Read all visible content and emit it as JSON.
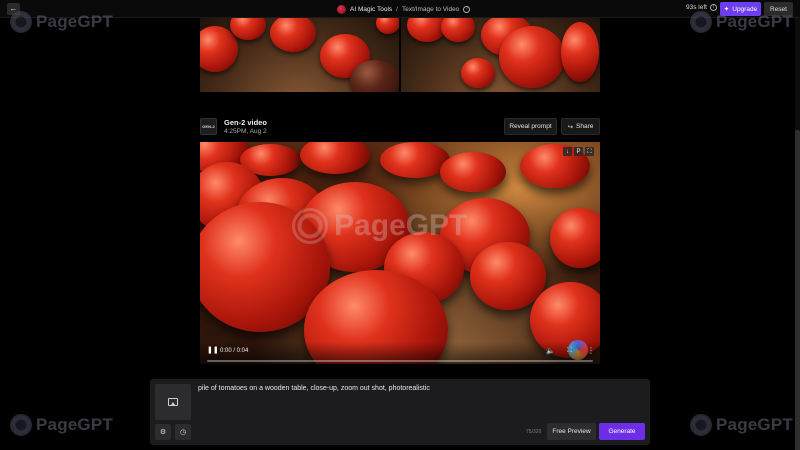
{
  "header": {
    "back_icon": "←",
    "breadcrumb_root": "AI Magic Tools",
    "breadcrumb_sep": "/",
    "breadcrumb_current": "Text/Image to Video",
    "help_icon": "?",
    "credits": "93s left",
    "info_icon": "i",
    "upgrade_icon": "✦",
    "upgrade_label": "Upgrade",
    "reset_label": "Reset"
  },
  "watermark": {
    "text": "PageGPT"
  },
  "result": {
    "avatar_text": "GEN-2",
    "title": "Gen-2 video",
    "timestamp": "4:25PM, Aug 2",
    "reveal_label": "Reveal prompt",
    "share_icon": "↪",
    "share_label": "Share"
  },
  "video": {
    "top_icons": [
      "↓",
      "P",
      "⛶"
    ],
    "play_icon": "❚❚",
    "time": "0:00 / 0:04",
    "mute_icon": "🔈",
    "fullscreen_icon": "⛶",
    "more_icon": "⋮",
    "progress_fraction": 0.0
  },
  "composer": {
    "prompt": "pile of tomatoes on a wooden table, close-up, zoom out shot, photorealistic",
    "settings_icon": "⚙",
    "history_icon": "◷",
    "char_count": "75/320",
    "free_preview_label": "Free Preview",
    "generate_label": "Generate"
  },
  "colors": {
    "accent": "#6d2ee8",
    "upgrade": "#6d3df0",
    "background": "#000000",
    "panel": "#1c1c1e"
  }
}
